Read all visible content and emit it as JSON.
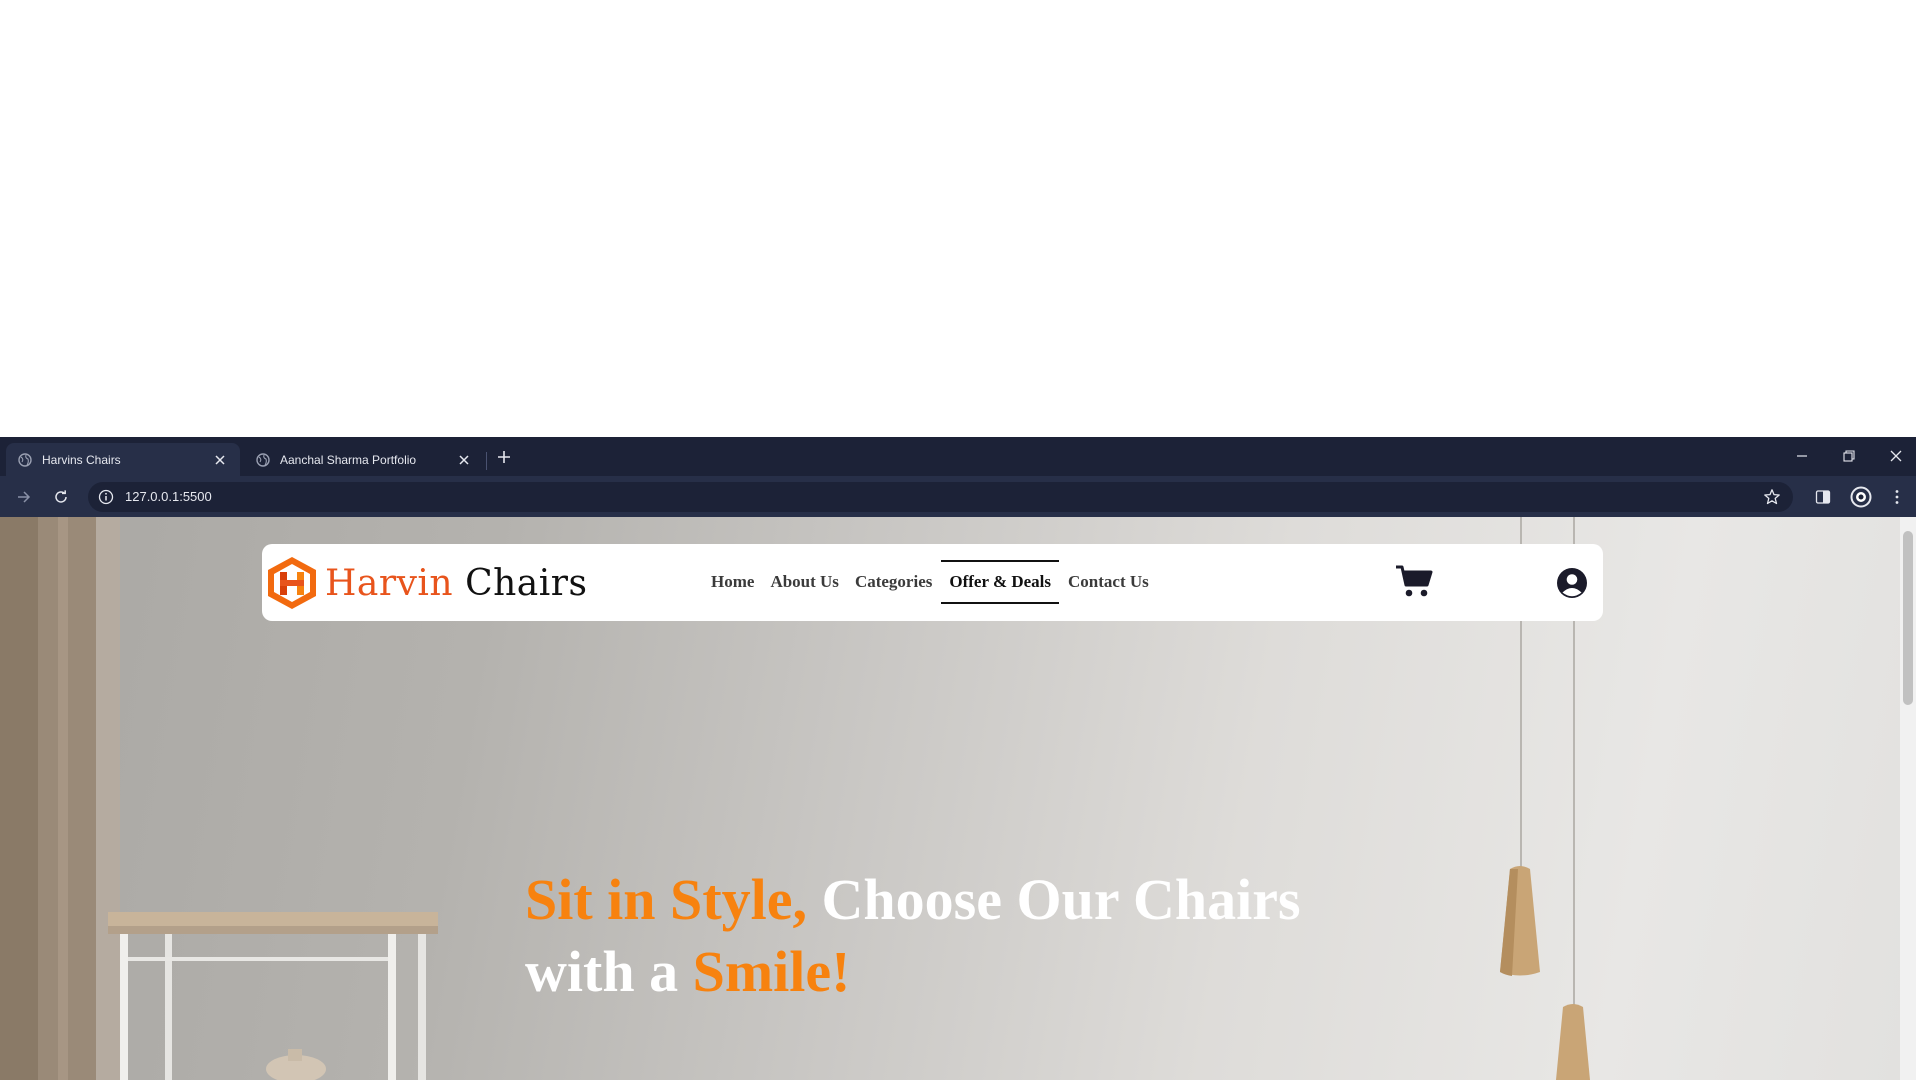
{
  "browser": {
    "tabs": [
      {
        "title": "Harvins Chairs",
        "active": true
      },
      {
        "title": "Aanchal Sharma Portfolio",
        "active": false
      }
    ],
    "url": "127.0.0.1:5500",
    "colors": {
      "frame": "#1c2237",
      "toolbar": "#272f48"
    }
  },
  "site": {
    "brand": {
      "word1": "Harvin",
      "word2": "Chairs",
      "logo_icon": "hexagon-h-logo"
    },
    "nav": {
      "items": [
        {
          "label": "Home",
          "active": false
        },
        {
          "label": "About Us",
          "active": false
        },
        {
          "label": "Categories",
          "active": false
        },
        {
          "label": "Offer & Deals",
          "active": true
        },
        {
          "label": "Contact Us",
          "active": false
        }
      ]
    },
    "icons": {
      "cart": "cart-icon",
      "user": "user-circle-icon"
    },
    "hero": {
      "part1": "Sit in Style,",
      "part2": " Choose Our Chairs with a ",
      "part3": "Smile!"
    },
    "colors": {
      "accent": "#f7820f",
      "brand_orange": "#e8541c",
      "nav_text": "#3b3b3b"
    }
  }
}
